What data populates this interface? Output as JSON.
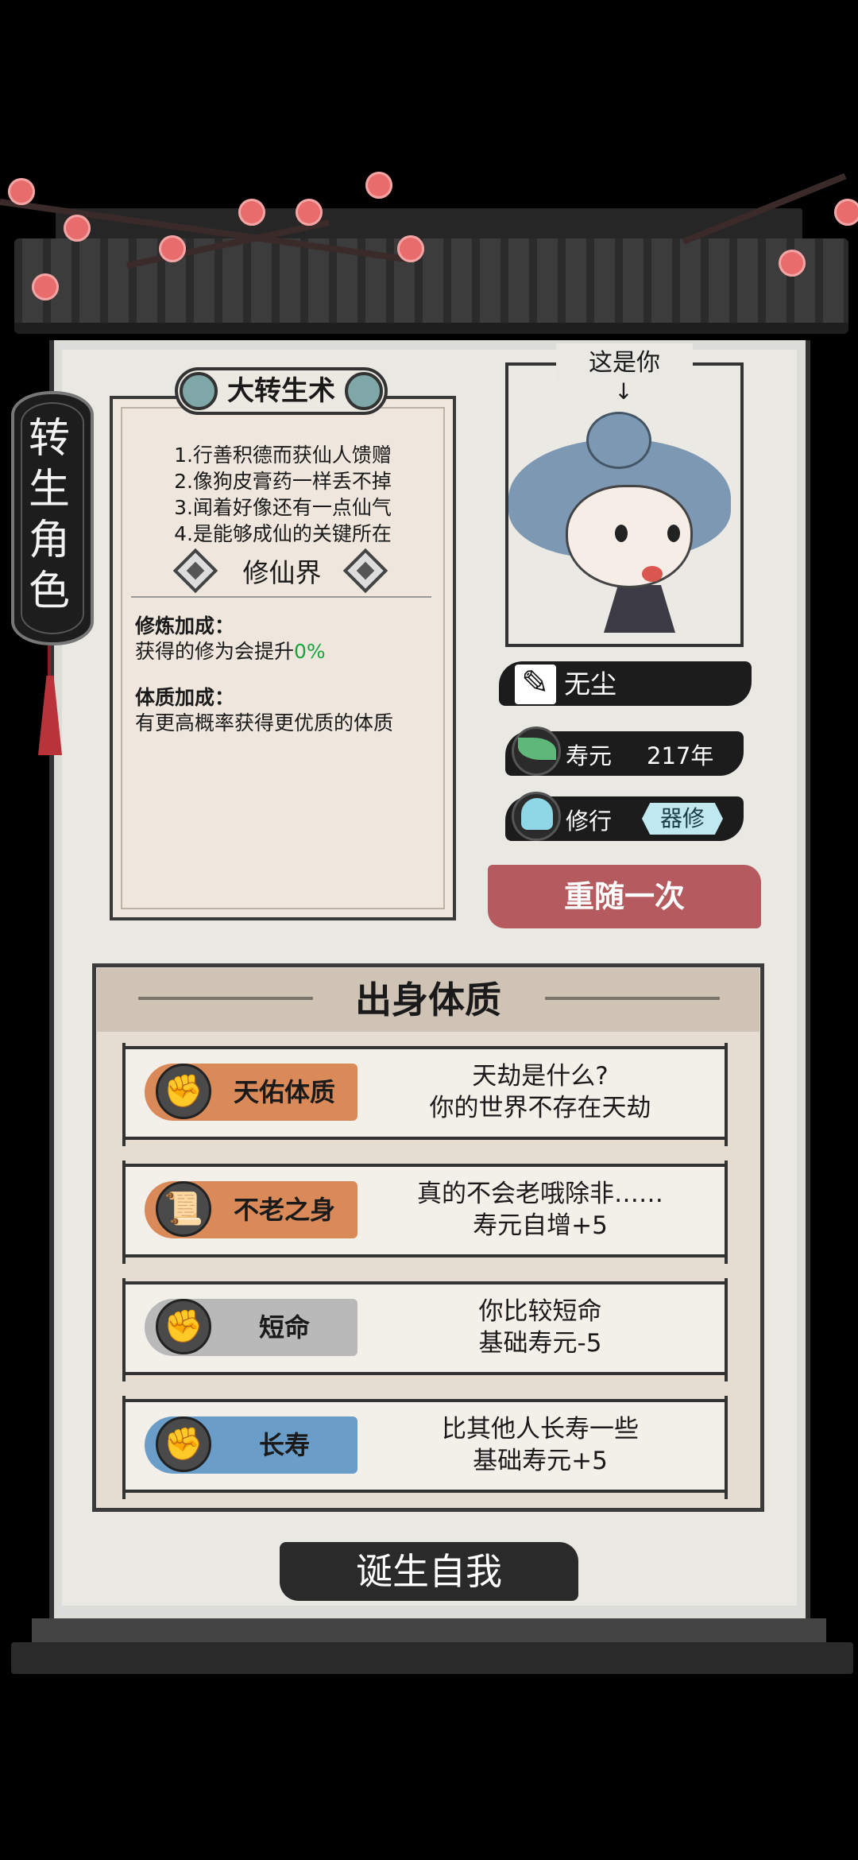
{
  "side_tab": {
    "title": "转生角色"
  },
  "spell": {
    "title": "大转生术",
    "lines": [
      "1.行善积德而获仙人馈赠",
      "2.像狗皮膏药一样丢不掉",
      "3.闻着好像还有一点仙气",
      "4.是能够成仙的关键所在"
    ],
    "realm": "修仙界",
    "cultivation_label": "修炼加成：",
    "cultivation_text": "获得的修为会提升",
    "cultivation_value": "0%",
    "physique_label": "体质加成：",
    "physique_text": "有更高概率获得更优质的体质"
  },
  "portrait": {
    "label": "这是你",
    "arrow": "↓"
  },
  "character": {
    "name": "无尘",
    "lifespan_label": "寿元",
    "lifespan_value": "217年",
    "path_label": "修行",
    "path_value": "器修"
  },
  "reroll_button": "重随一次",
  "origin": {
    "title": "出身体质",
    "traits": [
      {
        "name": "天佑体质",
        "line1": "天劫是什么?",
        "line2": "你的世界不存在天劫",
        "color": "#d98a58",
        "icon": "fist-icon"
      },
      {
        "name": "不老之身",
        "line1": "真的不会老哦除非……",
        "line2": "寿元自增+5",
        "color": "#d98a58",
        "icon": "scroll-icon"
      },
      {
        "name": "短命",
        "line1": "你比较短命",
        "line2": "基础寿元-5",
        "color": "#b9b9b9",
        "icon": "fist-icon"
      },
      {
        "name": "长寿",
        "line1": "比其他人长寿一些",
        "line2": "基础寿元+5",
        "color": "#6a9dc7",
        "icon": "fist-icon"
      }
    ]
  },
  "birth_button": "诞生自我"
}
